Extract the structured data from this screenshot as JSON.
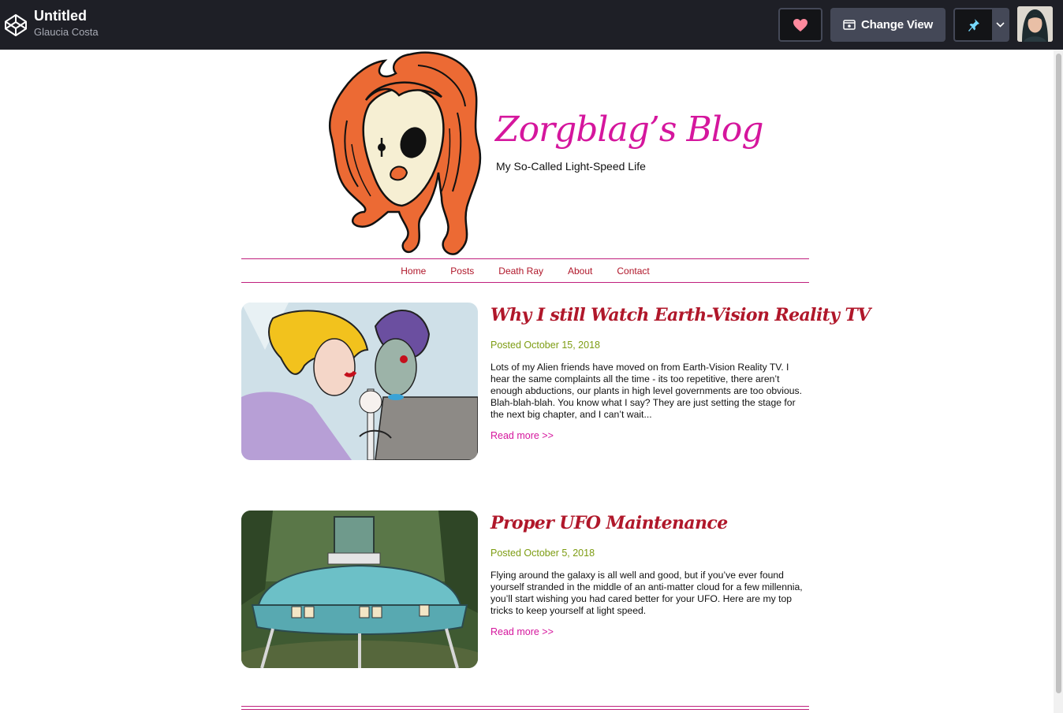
{
  "topbar": {
    "title": "Untitled",
    "author": "Glaucia Costa",
    "change_view_label": "Change View",
    "colors": {
      "bg": "#1e1f26",
      "heart": "#ff6b8b",
      "pin": "#47cf73"
    }
  },
  "site": {
    "title": "Zorgblag’s Blog",
    "tagline": "My So-Called Light-Speed Life",
    "colors": {
      "title": "#d5169d",
      "nav": "#b0172a",
      "rule": "#c0207d",
      "date": "#7d9c12"
    }
  },
  "nav": {
    "items": [
      "Home",
      "Posts",
      "Death Ray",
      "About",
      "Contact"
    ]
  },
  "posts": [
    {
      "title": "Why I still Watch Earth-Vision Reality TV",
      "date": "Posted October 15, 2018",
      "excerpt": "Lots of my Alien friends have moved on from Earth-Vision Reality TV. I hear the same complaints all the time - its too repetitive, there aren’t enough abductions, our plants in high level governments are too obvious. Blah-blah-blah. You know what I say? They are just setting the stage for the next big chapter, and I can’t wait...",
      "read_more": "Read more >>"
    },
    {
      "title": "Proper UFO Maintenance",
      "date": "Posted October 5, 2018",
      "excerpt": "Flying around the galaxy is all well and good, but if you’ve ever found yourself stranded in the middle of an anti-matter cloud for a few millennia, you’ll start wishing you had cared better for your UFO. Here are my top tricks to keep yourself at light speed.",
      "read_more": "Read more >>"
    }
  ]
}
